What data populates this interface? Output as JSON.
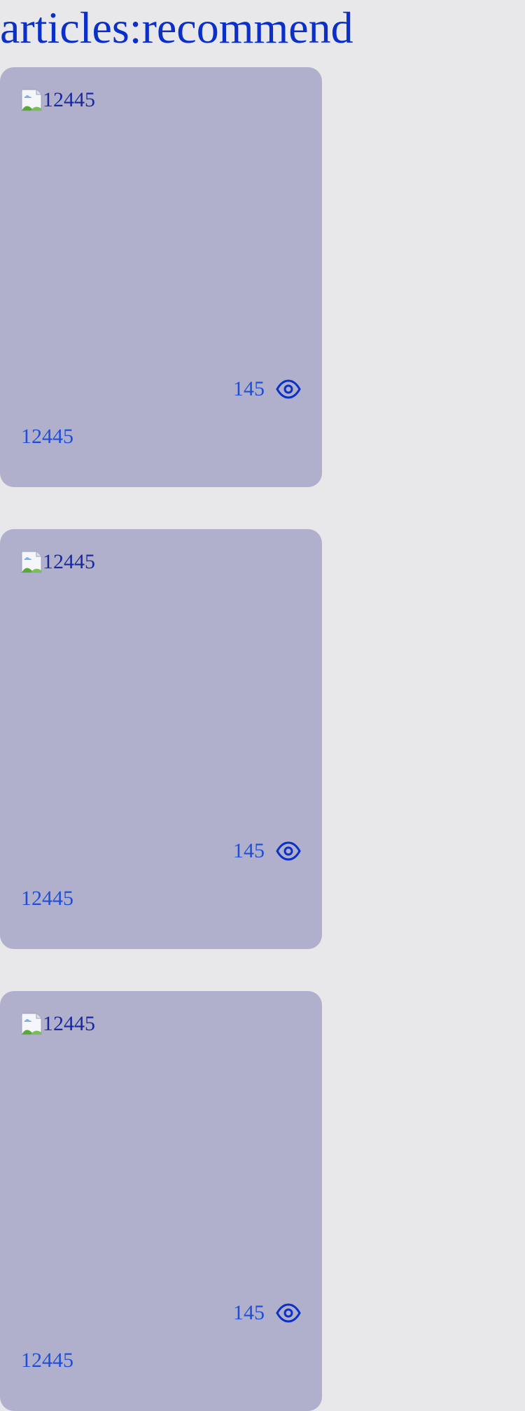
{
  "page": {
    "title": "articles:recommend"
  },
  "colors": {
    "background": "#e8e8eb",
    "card_background": "#b0b0cc",
    "title_text": "#0b2fc9",
    "card_text": "#1f4fd6",
    "icon_stroke": "#0b2fc9"
  },
  "articles": [
    {
      "image_alt": "12445",
      "views": "145",
      "title": "12445",
      "views_icon": "eye-icon"
    },
    {
      "image_alt": "12445",
      "views": "145",
      "title": "12445",
      "views_icon": "eye-icon"
    },
    {
      "image_alt": "12445",
      "views": "145",
      "title": "12445",
      "views_icon": "eye-icon"
    }
  ]
}
